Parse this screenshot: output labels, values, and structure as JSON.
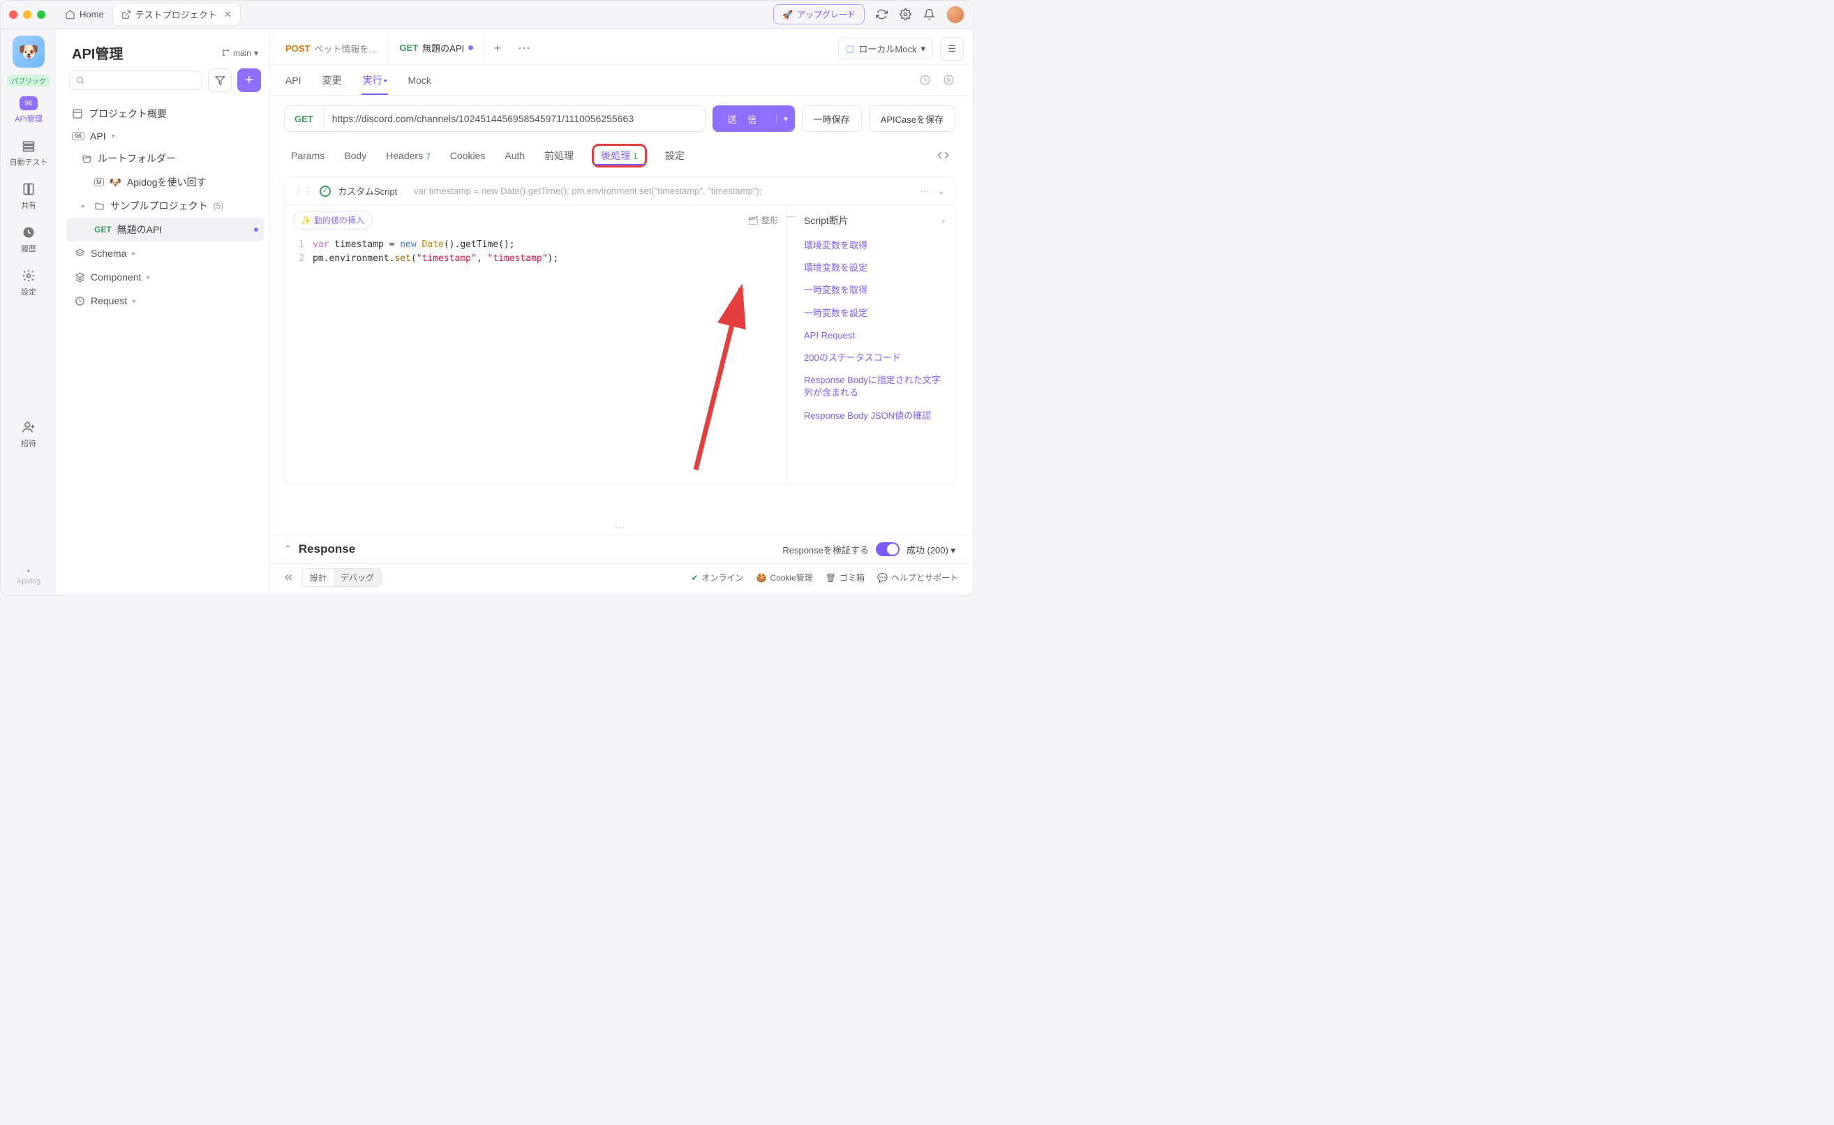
{
  "titlebar": {
    "home": "Home",
    "tab_title": "テストプロジェクト",
    "upgrade": "アップグレード"
  },
  "rail": {
    "public": "パブリック",
    "api_mgmt": "API管理",
    "auto_test": "自動テスト",
    "share": "共有",
    "history": "履歴",
    "settings": "設定",
    "invite": "招待",
    "brand": "Apidog"
  },
  "sidebar": {
    "title": "API管理",
    "branch": "main",
    "overview": "プロジェクト概要",
    "api_root": "API",
    "root_folder": "ルートフォルダー",
    "sample_md": "Apidogを使い回す",
    "sample_proj": "サンプルプロジェクト",
    "sample_proj_count": "(5)",
    "selected_method": "GET",
    "selected_name": "無題のAPI",
    "schema": "Schema",
    "component": "Component",
    "request": "Request"
  },
  "tabs": {
    "t1_method": "POST",
    "t1_label": "ペット情報を…",
    "t2_method": "GET",
    "t2_label": "無題のAPI"
  },
  "env": {
    "label": "ローカルMock"
  },
  "subtabs": {
    "api": "API",
    "change": "変更",
    "run": "実行",
    "mock": "Mock"
  },
  "urlbar": {
    "method": "GET",
    "url": "https://discord.com/channels/1024514456958545971/1110056255663",
    "send": "送 信",
    "save_temp": "一時保存",
    "save_case": "APICaseを保存"
  },
  "reqtabs": {
    "params": "Params",
    "body": "Body",
    "headers": "Headers",
    "headers_count": "7",
    "cookies": "Cookies",
    "auth": "Auth",
    "pre": "前処理",
    "post": "後処理",
    "post_count": "1",
    "settings": "設定"
  },
  "script": {
    "title": "カスタムScript",
    "preview": "var timestamp = new Date().getTime(); pm.environment.set(\"timestamp\", \"timestamp\");",
    "insert_dynamic": "動的値の挿入",
    "format": "整形",
    "lines": {
      "l1_a": "var",
      "l1_b": " timestamp = ",
      "l1_c": "new",
      "l1_d": " ",
      "l1_e": "Date",
      "l1_f": "().getTime();",
      "l2_a": "pm.environment.",
      "l2_b": "set",
      "l2_c": "(",
      "l2_d": "\"timestamp\"",
      "l2_e": ", ",
      "l2_f": "\"timestamp\"",
      "l2_g": ");"
    }
  },
  "snippets": {
    "title": "Script断片",
    "items": [
      "環境変数を取得",
      "環境変数を設定",
      "一時変数を取得",
      "一時変数を設定",
      "API Request",
      "200のステータスコード",
      "Response Bodyに指定された文字列が含まれる",
      "Response Body JSON値の確認"
    ]
  },
  "response": {
    "title": "Response",
    "verify_label": "Responseを検証する",
    "status": "成功 (200)"
  },
  "footer": {
    "design": "設計",
    "debug": "デバッグ",
    "online": "オンライン",
    "cookie": "Cookie管理",
    "trash": "ゴミ箱",
    "help": "ヘルプとサポート"
  }
}
